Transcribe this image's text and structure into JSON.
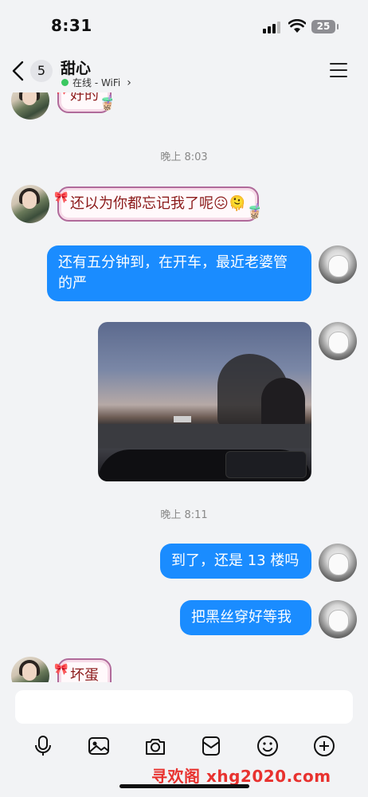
{
  "status_bar": {
    "time": "8:31",
    "battery": "25"
  },
  "header": {
    "back_count": "5",
    "title": "甜心",
    "status": "在线 - WiFi"
  },
  "messages": [
    {
      "side": "left",
      "type": "text",
      "text": "好的"
    },
    {
      "type": "time",
      "text": "晚上 8:03"
    },
    {
      "side": "left",
      "type": "text",
      "text": "还以为你都忘记我了呢😖🫠"
    },
    {
      "side": "right",
      "type": "text",
      "text": "还有五分钟到，在开车，最近老婆管的严"
    },
    {
      "side": "right",
      "type": "image"
    },
    {
      "type": "time",
      "text": "晚上 8:11"
    },
    {
      "side": "right",
      "type": "text",
      "text": "到了，还是 13 楼吗"
    },
    {
      "side": "right",
      "type": "text",
      "text": "把黑丝穿好等我"
    },
    {
      "side": "left",
      "type": "text",
      "text": "坏蛋"
    }
  ],
  "input": {
    "placeholder": ""
  },
  "toolbar": [
    "mic-icon",
    "image-icon",
    "camera-icon",
    "red-packet-icon",
    "emoji-icon",
    "plus-icon"
  ],
  "watermark": "寻欢阁 xhg2020.com",
  "colors": {
    "accent": "#1a8cff",
    "online": "#3ac760",
    "background": "#f2f3f5"
  }
}
